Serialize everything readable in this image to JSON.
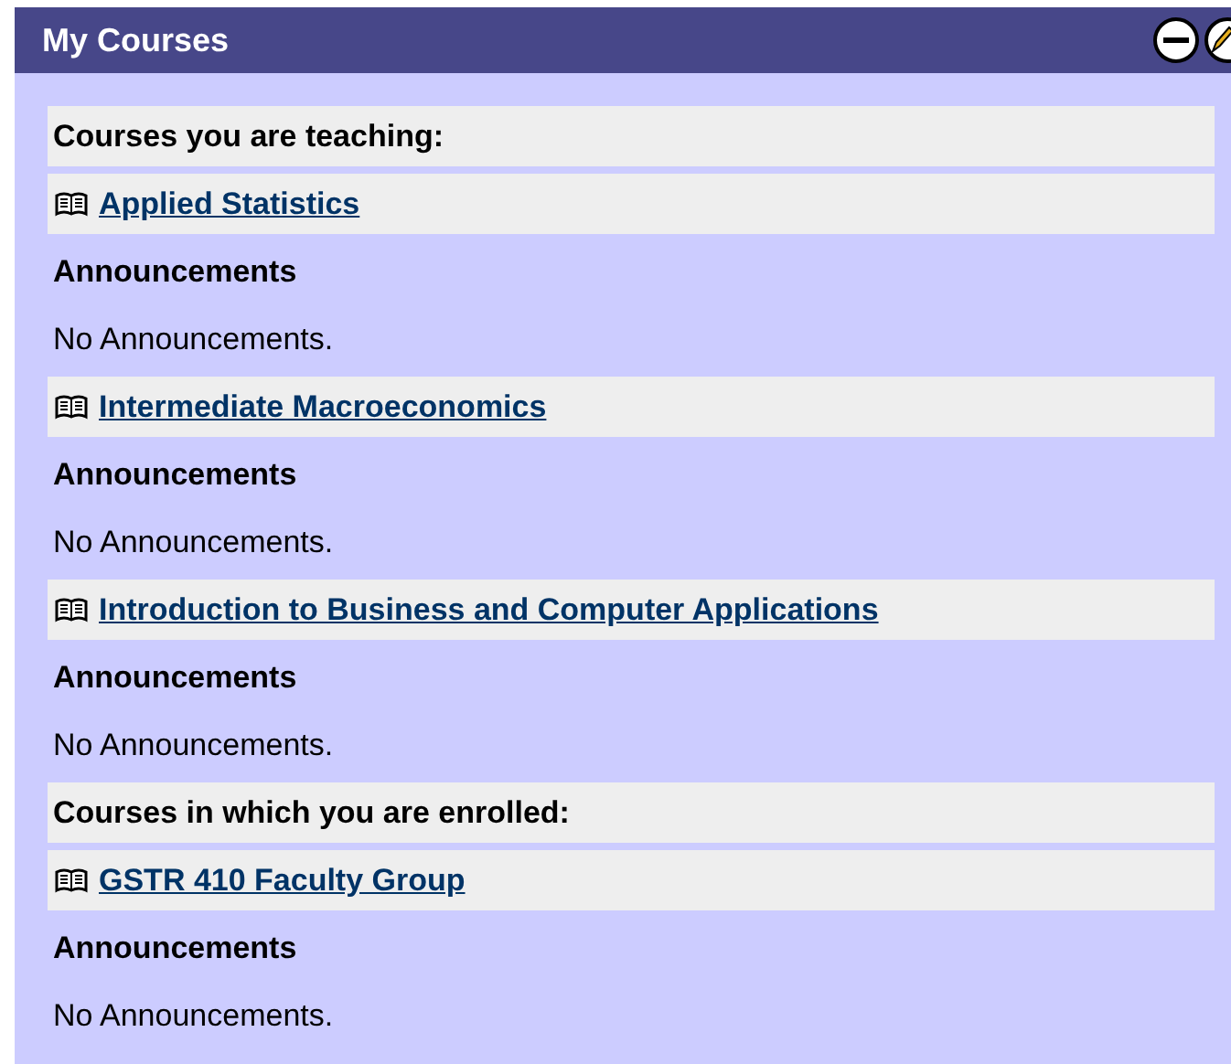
{
  "panel": {
    "title": "My Courses"
  },
  "sections": [
    {
      "heading": "Courses you are teaching:",
      "courses": [
        {
          "title": "Applied Statistics",
          "announcements_label": "Announcements",
          "announcements_text": "No Announcements."
        },
        {
          "title": "Intermediate Macroeconomics",
          "announcements_label": "Announcements",
          "announcements_text": "No Announcements."
        },
        {
          "title": "Introduction to Business and Computer Applications",
          "announcements_label": "Announcements",
          "announcements_text": "No Announcements."
        }
      ]
    },
    {
      "heading": "Courses in which you are enrolled:",
      "courses": [
        {
          "title": "GSTR 410 Faculty Group",
          "announcements_label": "Announcements",
          "announcements_text": "No Announcements."
        }
      ]
    }
  ]
}
